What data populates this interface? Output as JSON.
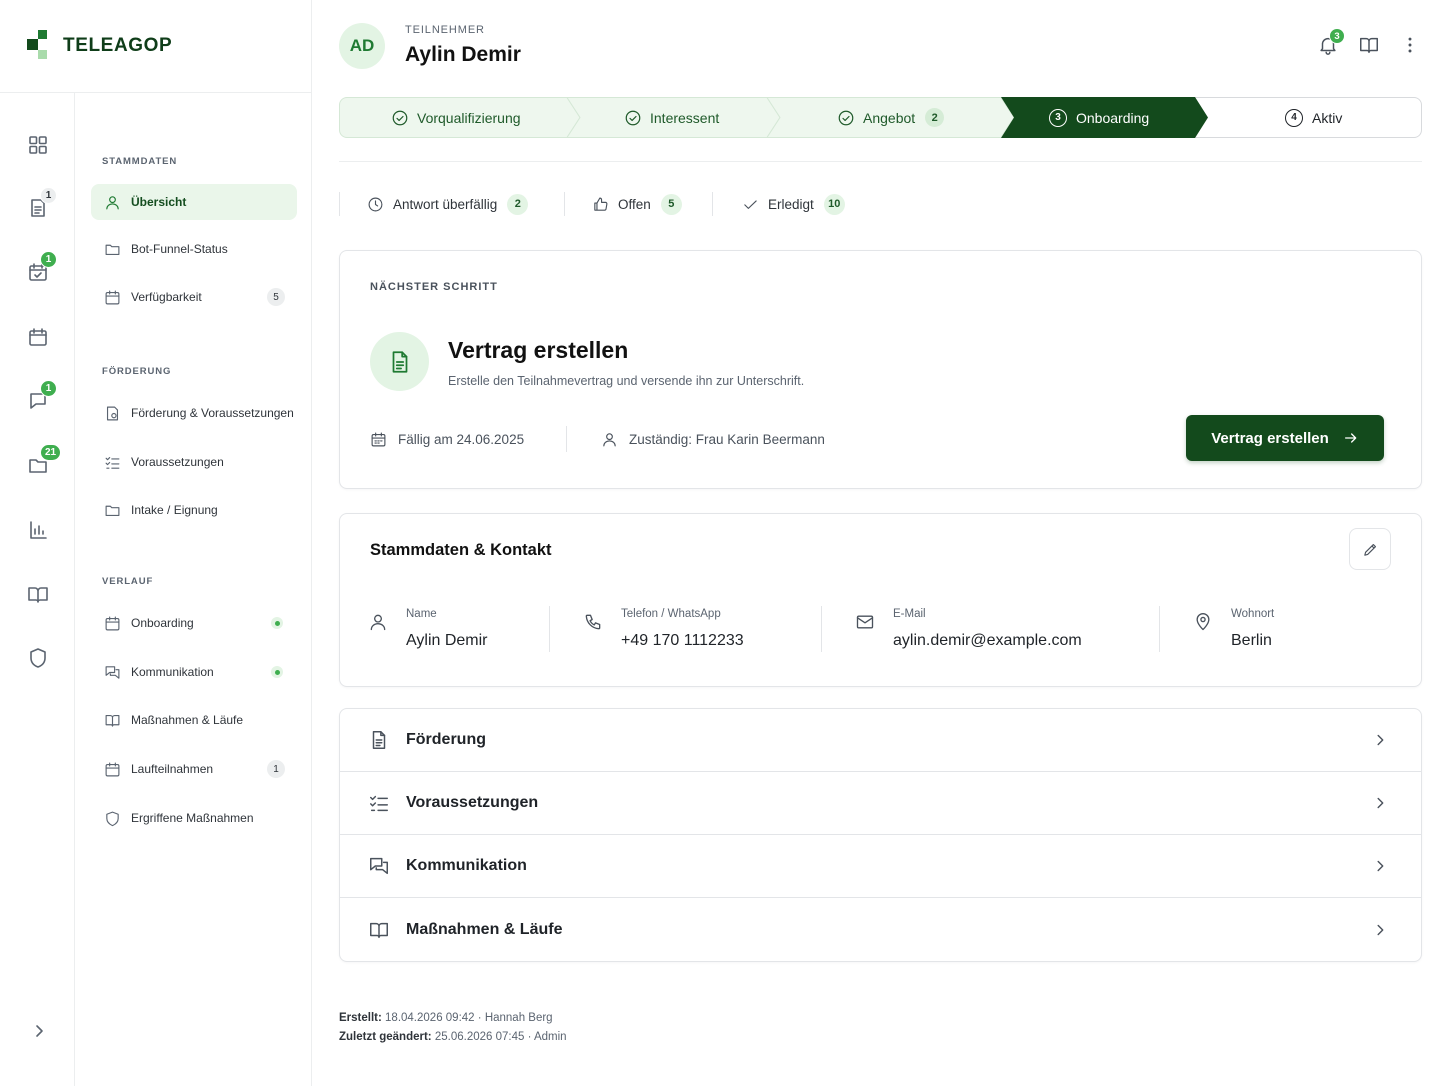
{
  "brand": {
    "name": "TELEAGOP",
    "colors": {
      "primary": "#134a1c",
      "accent": "#3fae4f",
      "soft": "#e3f4e4"
    }
  },
  "rail": {
    "items": [
      {
        "icon": "dashboard-grid-icon",
        "badge": ""
      },
      {
        "icon": "document-list-icon",
        "badge": "1"
      },
      {
        "icon": "calendar-check-icon",
        "badge": "1"
      },
      {
        "icon": "calendar-icon",
        "badge": ""
      },
      {
        "icon": "chat-bubble-icon",
        "badge": "1"
      },
      {
        "icon": "folder-icon",
        "badge": "21"
      },
      {
        "icon": "bar-chart-icon",
        "badge": ""
      },
      {
        "icon": "book-open-icon",
        "badge": ""
      },
      {
        "icon": "shield-icon",
        "badge": ""
      }
    ],
    "collapse_icon": "chevron-right-icon"
  },
  "subnav": {
    "sections": [
      {
        "title": "STAMMDATEN",
        "items": [
          {
            "label": "Übersicht",
            "icon": "user-icon",
            "active": true
          },
          {
            "label": "Bot-Funnel-Status",
            "icon": "folder-icon"
          },
          {
            "label": "Verfügbarkeit",
            "icon": "calendar-icon",
            "count": "5"
          }
        ]
      },
      {
        "title": "FÖRDERUNG",
        "items": [
          {
            "label": "Förderung & Voraussetzungen",
            "icon": "document-euro-icon"
          },
          {
            "label": "Voraussetzungen",
            "icon": "checklist-icon"
          },
          {
            "label": "Intake / Eignung",
            "icon": "folder-icon"
          }
        ]
      },
      {
        "title": "VERLAUF",
        "items": [
          {
            "label": "Onboarding",
            "icon": "calendar-icon",
            "dot": true
          },
          {
            "label": "Kommunikation",
            "icon": "chat-bubbles-icon",
            "dot": true
          },
          {
            "label": "Maßnahmen & Läufe",
            "icon": "book-open-icon"
          },
          {
            "label": "Laufteilnahmen",
            "icon": "calendar-icon",
            "count": "1"
          },
          {
            "label": "Ergriffene Maßnahmen",
            "icon": "shield-icon"
          }
        ]
      }
    ]
  },
  "header": {
    "avatar_initials": "AD",
    "role": "TEILNEHMER",
    "name": "Aylin Demir",
    "notifications_count": "3"
  },
  "stepper": {
    "steps": [
      {
        "label": "Vorqualifizierung",
        "state": "done"
      },
      {
        "label": "Interessent",
        "state": "done"
      },
      {
        "label": "Angebot",
        "state": "done",
        "badge": "2"
      },
      {
        "label": "Onboarding",
        "state": "current",
        "number": "3"
      },
      {
        "label": "Aktiv",
        "state": "upcoming",
        "number": "4"
      }
    ]
  },
  "filters": [
    {
      "label": "Antwort überfällig",
      "count": "2",
      "icon": "clock-icon"
    },
    {
      "label": "Offen",
      "count": "5",
      "icon": "thumbs-up-icon"
    },
    {
      "label": "Erledigt",
      "count": "10",
      "icon": "check-icon"
    }
  ],
  "next_step": {
    "label": "NÄCHSTER SCHRITT",
    "title": "Vertrag erstellen",
    "subtitle": "Erstelle den Teilnahmevertrag und versende ihn zur Unterschrift.",
    "due": "Fällig am 24.06.2025",
    "owner": "Zuständig: Frau Karin Beermann",
    "button": "Vertrag erstellen"
  },
  "contact": {
    "title": "Stammdaten & Kontakt",
    "fields": [
      {
        "label": "Name",
        "value": "Aylin Demir",
        "icon": "user-icon"
      },
      {
        "label": "Telefon / WhatsApp",
        "value": "+49 170 1112233",
        "icon": "phone-icon"
      },
      {
        "label": "E-Mail",
        "value": "aylin.demir@example.com",
        "icon": "mail-icon"
      },
      {
        "label": "Wohnort",
        "value": "Berlin",
        "icon": "map-pin-icon"
      }
    ]
  },
  "accordion": [
    {
      "label": "Förderung",
      "icon": "document-icon"
    },
    {
      "label": "Voraussetzungen",
      "icon": "checklist-icon"
    },
    {
      "label": "Kommunikation",
      "icon": "chat-bubbles-icon"
    },
    {
      "label": "Maßnahmen & Läufe",
      "icon": "book-open-icon"
    }
  ],
  "footer": {
    "created_label": "Erstellt:",
    "created_value": "18.04.2026 09:42",
    "created_by": "Hannah Berg",
    "changed_label": "Zuletzt geändert:",
    "changed_value": "25.06.2026 07:45",
    "changed_by": "Admin",
    "separator": "·"
  }
}
